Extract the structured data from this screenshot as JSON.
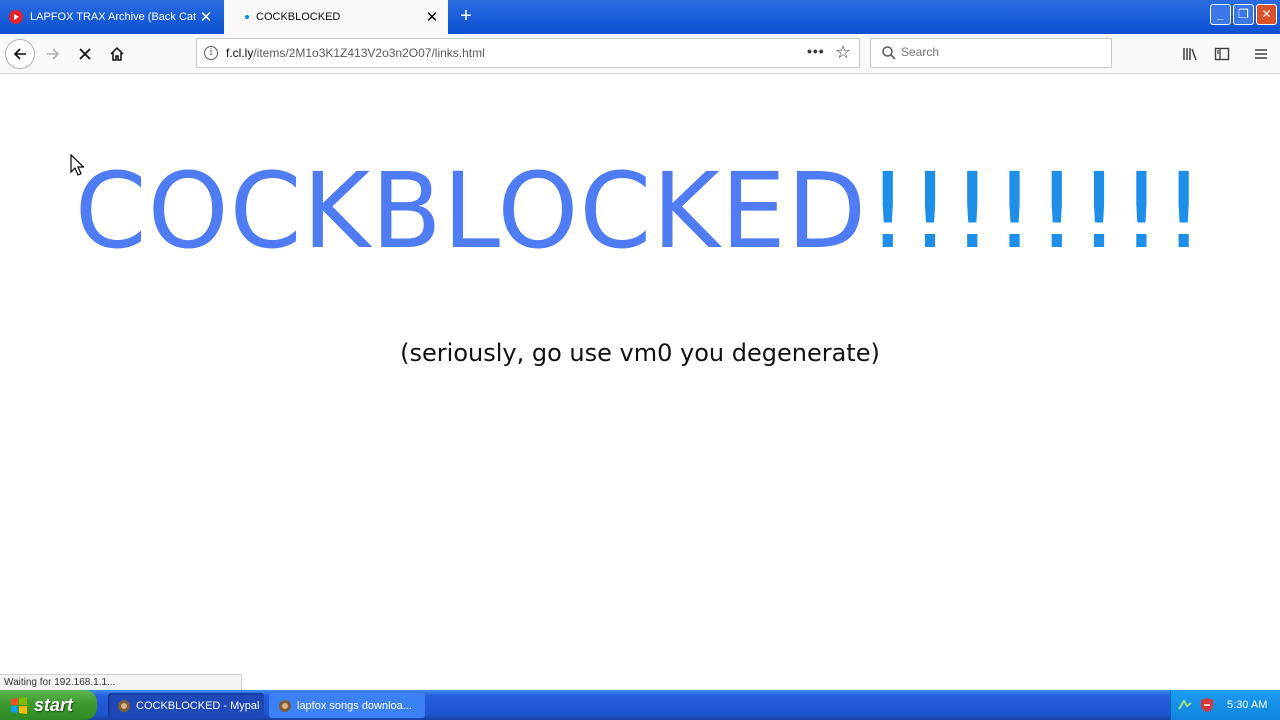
{
  "browser": {
    "tabs": [
      {
        "title": "LAPFOX TRAX Archive (Back Catal",
        "active": false
      },
      {
        "title": "COCKBLOCKED",
        "active": true
      }
    ],
    "url": {
      "host": "f.cl.ly",
      "path": "/items/2M1o3K1Z413V2o3n2O07/links.html"
    },
    "search_placeholder": "Search",
    "icons": {
      "back": "back-arrow-icon",
      "forward": "forward-arrow-icon",
      "stop": "stop-icon",
      "home": "home-icon",
      "library": "library-icon",
      "sidebar": "sidebar-icon",
      "menu": "hamburger-menu-icon"
    }
  },
  "page": {
    "headline_word": "COCKBLOCKED",
    "headline_bangs": "!!!!!!!!",
    "subtitle": "(seriously, go use vm0 you degenerate)",
    "colors": {
      "headline": "#4f7cf3",
      "bangs": "#1e8fe8"
    }
  },
  "status": {
    "text": "Waiting for 192.168.1.1..."
  },
  "taskbar": {
    "start_label": "start",
    "tasks": [
      {
        "label": "COCKBLOCKED - Mypal",
        "active": true
      },
      {
        "label": "lapfox songs downloa...",
        "active": false
      }
    ],
    "clock": "5:30 AM"
  }
}
